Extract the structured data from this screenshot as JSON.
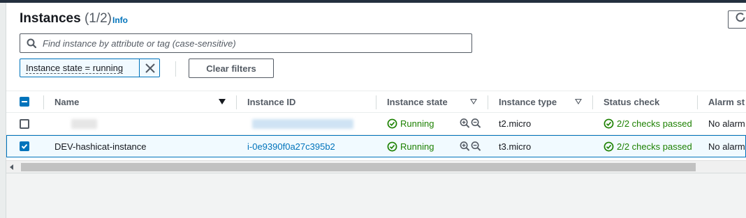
{
  "header": {
    "title": "Instances",
    "count": "(1/2)",
    "info": "Info"
  },
  "search": {
    "placeholder": "Find instance by attribute or tag (case-sensitive)",
    "value": ""
  },
  "filter_token": {
    "label": "Instance state = running"
  },
  "clear_filters": "Clear filters",
  "columns": [
    "Name",
    "Instance ID",
    "Instance state",
    "Instance type",
    "Status check",
    "Alarm st"
  ],
  "rows": [
    {
      "name": "",
      "instance_id": "",
      "state": "Running",
      "type": "t2.micro",
      "status": "2/2 checks passed",
      "alarm": "No alarm",
      "selected": false
    },
    {
      "name": "DEV-hashicat-instance",
      "instance_id": "i-0e9390f0a27c395b2",
      "state": "Running",
      "type": "t3.micro",
      "status": "2/2 checks passed",
      "alarm": "No alarm",
      "selected": true
    }
  ],
  "colors": {
    "link": "#0073bb",
    "success": "#1d8102",
    "selection_bg": "#f1faff"
  },
  "icons": [
    "refresh-icon",
    "search-icon",
    "close-icon",
    "sort-down-icon",
    "check-circle-icon",
    "zoom-in-icon",
    "zoom-out-icon"
  ]
}
